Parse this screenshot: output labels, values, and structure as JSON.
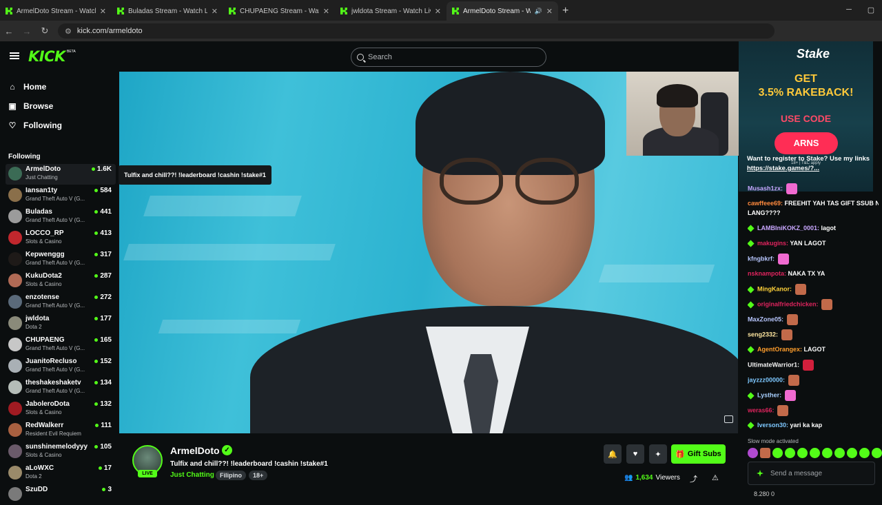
{
  "browser": {
    "tabs": [
      {
        "title": "ArmelDoto Stream - Watch Live",
        "active": false
      },
      {
        "title": "Buladas Stream - Watch Live on",
        "active": false
      },
      {
        "title": "CHUPAENG Stream - Watch Live",
        "active": false
      },
      {
        "title": "jwldota Stream - Watch Live on",
        "active": false
      },
      {
        "title": "ArmelDoto Stream - Watch",
        "active": true
      }
    ],
    "url": "kick.com/armeldoto"
  },
  "header": {
    "logo": "KICK",
    "beta": "BETA",
    "search_placeholder": "Search"
  },
  "sidebar": {
    "nav": [
      {
        "label": "Home",
        "icon": "home-icon"
      },
      {
        "label": "Browse",
        "icon": "browse-icon"
      },
      {
        "label": "Following",
        "icon": "heart-icon"
      }
    ],
    "following_heading": "Following",
    "channels": [
      {
        "name": "ArmelDoto",
        "category": "Just Chatting",
        "viewers": "1.6K",
        "color": "#3b6b55"
      },
      {
        "name": "Iansan1ty",
        "category": "Grand Theft Auto V (G...",
        "viewers": "584",
        "color": "#8a6f4a"
      },
      {
        "name": "Buladas",
        "category": "Grand Theft Auto V (G...",
        "viewers": "441",
        "color": "#9b9b9b"
      },
      {
        "name": "LOCCO_RP",
        "category": "Slots & Casino",
        "viewers": "413",
        "color": "#c0272d"
      },
      {
        "name": "Kepwenggg",
        "category": "Grand Theft Auto V (G...",
        "viewers": "317",
        "color": "#1e1a18"
      },
      {
        "name": "KukuDota2",
        "category": "Slots & Casino",
        "viewers": "287",
        "color": "#b06a55"
      },
      {
        "name": "enzotense",
        "category": "Grand Theft Auto V (G...",
        "viewers": "272",
        "color": "#5a6a7a"
      },
      {
        "name": "jwldota",
        "category": "Dota 2",
        "viewers": "177",
        "color": "#8a8a7a"
      },
      {
        "name": "CHUPAENG",
        "category": "Grand Theft Auto V (G...",
        "viewers": "165",
        "color": "#c7c7c7"
      },
      {
        "name": "JuanitoRecluso",
        "category": "Grand Theft Auto V (G...",
        "viewers": "152",
        "color": "#a9b0b5"
      },
      {
        "name": "theshakeshaketv",
        "category": "Grand Theft Auto V (G...",
        "viewers": "134",
        "color": "#b5bdb8"
      },
      {
        "name": "JaboleroDota",
        "category": "Slots & Casino",
        "viewers": "132",
        "color": "#a01b22"
      },
      {
        "name": "RedWalkerr",
        "category": "Resident Evil Requiem",
        "viewers": "111",
        "color": "#a86040"
      },
      {
        "name": "sunshinemelodyyy",
        "category": "Slots & Casino",
        "viewers": "105",
        "color": "#6a5a6a"
      },
      {
        "name": "aLoWXC",
        "category": "Dota 2",
        "viewers": "17",
        "color": "#9a8a6a"
      },
      {
        "name": "SzuDD",
        "category": "",
        "viewers": "3",
        "color": "#7a7a7a"
      }
    ]
  },
  "tooltip": "Tulfix and chill??! !leaderboard !cashin !stake#1",
  "stream": {
    "streamer": "ArmelDoto",
    "title": "Tulfix and chill??!  !leaderboard !cashin !stake#1",
    "category": "Just Chatting",
    "tags": [
      "Filipino",
      "18+"
    ],
    "live_label": "LIVE",
    "viewers_count": "1,634",
    "viewers_label": "Viewers",
    "gift_label": "Gift Subs"
  },
  "chat": {
    "ad": {
      "brand": "Stake",
      "line1": "GET",
      "line2": "3.5% RAKEBACK!",
      "line3": "USE CODE",
      "code": "ARNS",
      "terms": "18+ | T&C apply"
    },
    "promo_text": "Want to register to Stake? Use my links",
    "promo_link": "https://stake.games/?...",
    "messages": [
      {
        "user": "Musash1zx:",
        "text": "",
        "color": "#c5a7ff",
        "badge": false,
        "emote": "#f06ad0"
      },
      {
        "user": "cawffeee69:",
        "text": "FREEHIT YAH TAS GIFT SSUB NA",
        "color": "#ff8a3d",
        "badge": false,
        "emote": ""
      },
      {
        "user": "",
        "text": "LANG????",
        "color": "#ffffff",
        "badge": false,
        "emote": ""
      },
      {
        "user": "LAMBIniKOKZ_0001:",
        "text": "lagot",
        "color": "#c9a7ff",
        "badge": true,
        "emote": ""
      },
      {
        "user": "makugins:",
        "text": "YAN LAGOT",
        "color": "#e0245e",
        "badge": true,
        "emote": ""
      },
      {
        "user": "kfngbkrf:",
        "text": "",
        "color": "#b8c7ff",
        "badge": false,
        "emote": "#f06ad0"
      },
      {
        "user": "nsknampota:",
        "text": "NAKA TX YA",
        "color": "#e0245e",
        "badge": false,
        "emote": ""
      },
      {
        "user": "MingKanor:",
        "text": "",
        "color": "#ffd23a",
        "badge": true,
        "emote": "#c26a4a"
      },
      {
        "user": "originalfriedchicken:",
        "text": "",
        "color": "#e0245e",
        "badge": true,
        "emote": "#c26a4a"
      },
      {
        "user": "MaxZone05:",
        "text": "",
        "color": "#b8c7ff",
        "badge": false,
        "emote": "#c26a4a"
      },
      {
        "user": "seng2332:",
        "text": "",
        "color": "#ffe7a0",
        "badge": false,
        "emote": "#c26a4a"
      },
      {
        "user": "AgentOrangex:",
        "text": "LAGOT",
        "color": "#ff9e2c",
        "badge": true,
        "emote": ""
      },
      {
        "user": "UltimateWarrior1:",
        "text": "",
        "color": "#f2f2f2",
        "badge": false,
        "emote": "#d21f3c"
      },
      {
        "user": "jayzzz00000:",
        "text": "",
        "color": "#7ec8ff",
        "badge": false,
        "emote": "#c26a4a"
      },
      {
        "user": "Lysther:",
        "text": "",
        "color": "#a8d0ff",
        "badge": true,
        "emote": "#f06ad0"
      },
      {
        "user": "weras66:",
        "text": "",
        "color": "#e0245e",
        "badge": false,
        "emote": "#c26a4a"
      },
      {
        "user": "Iverson30:",
        "text": "yari ka kap",
        "color": "#7ec8ff",
        "badge": true,
        "emote": ""
      }
    ],
    "slow_mode": "Slow mode activated",
    "send_placeholder": "Send a message",
    "footer": "8,280   0"
  }
}
